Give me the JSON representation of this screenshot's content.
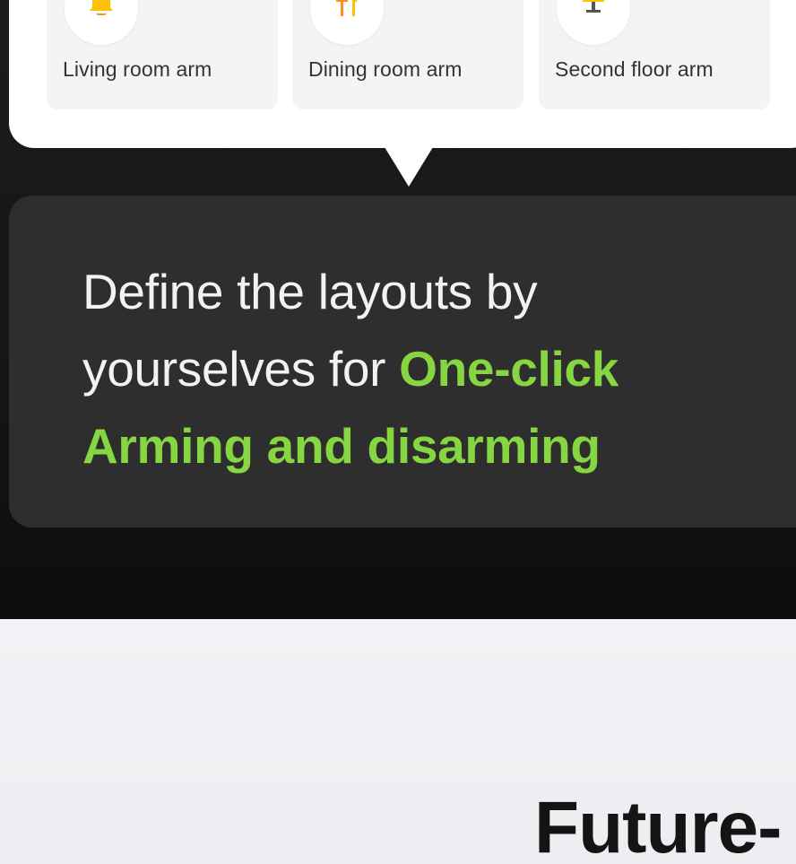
{
  "rooms": [
    {
      "label": "Living room arm",
      "icon": "bell-icon",
      "icon_color": "#ffc107"
    },
    {
      "label": "Dining room arm",
      "icon": "fork-knife-icon",
      "icon_color": "#ff8f1f"
    },
    {
      "label": "Second floor arm",
      "icon": "lamp-icon",
      "icon_color": "#ffc107"
    }
  ],
  "message": {
    "text_plain": "Define the layouts by yourselves for ",
    "text_accent": "One-click Arming and disarming"
  },
  "section": {
    "heading": "Future-"
  },
  "colors": {
    "accent": "#86d642",
    "dark_bg": "#161616",
    "bubble_bg": "#2e2e2e",
    "card_bg": "#ffffff",
    "light_bg": "#eef0f3"
  }
}
